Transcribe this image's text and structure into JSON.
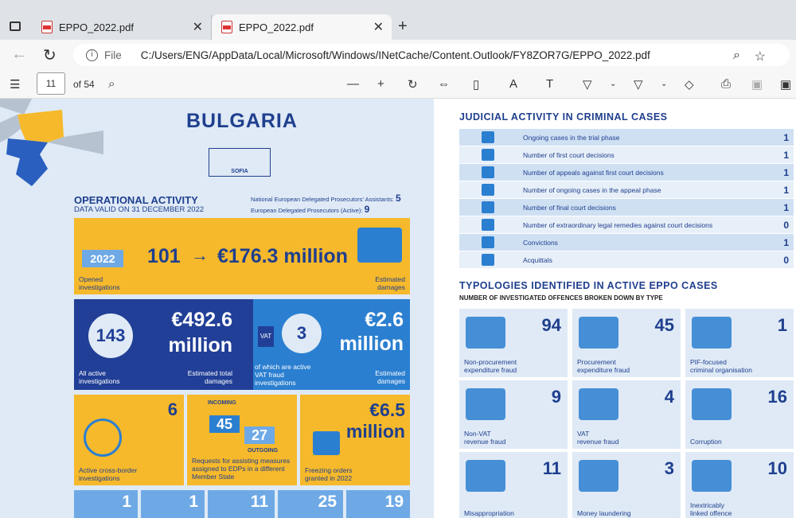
{
  "browser": {
    "tabs": [
      {
        "title": "EPPO_2022.pdf"
      },
      {
        "title": "EPPO_2022.pdf"
      }
    ],
    "file_label": "File",
    "url": "C:/Users/ENG/AppData/Local/Microsoft/Windows/INetCache/Content.Outlook/FY8ZOR7G/EPPO_2022.pdf"
  },
  "pdf_toolbar": {
    "page": "11",
    "of_pages": "of 54"
  },
  "left": {
    "country": "BULGARIA",
    "city": "SOFIA",
    "operational_title": "OPERATIONAL ACTIVITY",
    "data_valid": "DATA VALID ON 31 DECEMBER 2022",
    "nedpa_label": "National European Delegated Prosecutors' Assistants:",
    "nedpa_value": "5",
    "edp_label": "European Delegated Prosecutors (Active):",
    "edp_value": "9",
    "opened": {
      "year": "2022",
      "count": "101",
      "arrow": "→",
      "damages": "€176.3 million",
      "label_left": "Opened investigations",
      "label_right": "Estimated damages"
    },
    "active": {
      "count": "143",
      "damages_l1": "€492.6",
      "damages_l2": "million",
      "label_left": "All active investigations",
      "label_right": "Estimated total damages"
    },
    "vat": {
      "tag": "VAT",
      "count": "3",
      "damages_l1": "€2.6",
      "damages_l2": "million",
      "label_left": "of which are active VAT fraud investigations",
      "label_right": "Estimated damages"
    },
    "crossborder": {
      "count": "6",
      "label": "Active cross-border investigations"
    },
    "requests": {
      "incoming_label": "INCOMING",
      "incoming": "45",
      "outgoing": "27",
      "outgoing_label": "OUTGOING",
      "label": "Requests for assisting measures assigned to EDPs in a different Member State"
    },
    "freezing": {
      "l1": "€6.5",
      "l2": "million",
      "label": "Freezing orders granted in 2022"
    },
    "bottom_row": [
      "1",
      "1",
      "11",
      "25",
      "19"
    ]
  },
  "judicial": {
    "title": "JUDICIAL ACTIVITY IN CRIMINAL CASES",
    "rows": [
      {
        "label": "Ongoing cases in the trial phase",
        "value": "1"
      },
      {
        "label": "Number of first court decisions",
        "value": "1"
      },
      {
        "label": "Number of appeals against first court decisions",
        "value": "1"
      },
      {
        "label": "Number of ongoing cases in the appeal phase",
        "value": "1"
      },
      {
        "label": "Number of final court decisions",
        "value": "1"
      },
      {
        "label": "Number of extraordinary legal remedies against court decisions",
        "value": "0"
      },
      {
        "label": "Convictions",
        "value": "1"
      },
      {
        "label": "Acquittals",
        "value": "0"
      }
    ]
  },
  "typologies": {
    "title": "TYPOLOGIES IDENTIFIED IN ACTIVE EPPO CASES",
    "subtitle": "NUMBER OF INVESTIGATED OFFENCES BROKEN DOWN BY TYPE",
    "cards": [
      {
        "value": "94",
        "label1": "Non-procurement",
        "label2": "expenditure fraud"
      },
      {
        "value": "45",
        "label1": "Procurement",
        "label2": "expenditure fraud"
      },
      {
        "value": "1",
        "label1": "PIF-focused",
        "label2": "criminal organisation"
      },
      {
        "value": "9",
        "label1": "Non-VAT",
        "label2": "revenue fraud"
      },
      {
        "value": "4",
        "label1": "VAT",
        "label2": "revenue fraud"
      },
      {
        "value": "16",
        "label1": "Corruption",
        "label2": ""
      },
      {
        "value": "11",
        "label1": "Misappropriation",
        "label2": ""
      },
      {
        "value": "3",
        "label1": "Money laundering",
        "label2": ""
      },
      {
        "value": "10",
        "label1": "Inextricably",
        "label2": "linked offence"
      }
    ]
  }
}
